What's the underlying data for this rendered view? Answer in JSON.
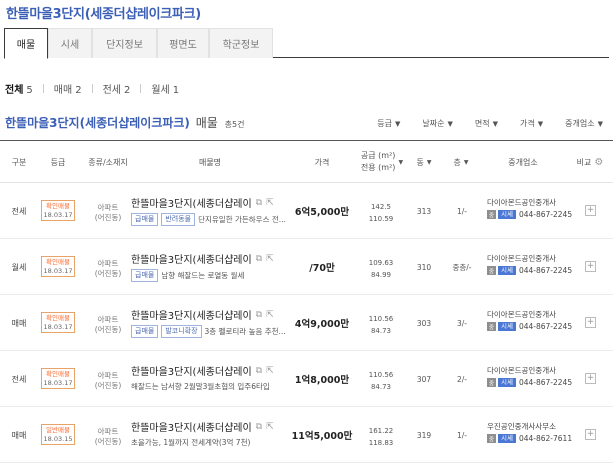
{
  "page": {
    "title": "한뜰마을3단지(세종더샵레이크파크)"
  },
  "tabs": [
    {
      "label": "매물",
      "active": true
    },
    {
      "label": "시세",
      "active": false
    },
    {
      "label": "단지정보",
      "active": false
    },
    {
      "label": "평면도",
      "active": false
    },
    {
      "label": "학군정보",
      "active": false
    }
  ],
  "filters": [
    {
      "label": "전체",
      "count": "5",
      "active": true
    },
    {
      "label": "매매",
      "count": "2",
      "active": false
    },
    {
      "label": "전세",
      "count": "2",
      "active": false
    },
    {
      "label": "월세",
      "count": "1",
      "active": false
    }
  ],
  "section": {
    "name": "한뜰마을3단지(세종더샵레이크파크)",
    "suffix": "매물",
    "total": "총5건"
  },
  "sorts": [
    "등급",
    "날짜순",
    "면적",
    "가격",
    "중개업소"
  ],
  "columns": {
    "type": "구분",
    "grade": "등급",
    "kind": "종류/소재지",
    "name": "매물명",
    "price": "가격",
    "supply": "공급 (m²)",
    "exclusive": "전용 (m²)",
    "dong": "동",
    "floor": "층",
    "agency": "중개업소",
    "compare": "비교"
  },
  "listings": [
    {
      "deal": "전세",
      "grade": "확인매물",
      "date": "18.03.17",
      "kind": "아파트",
      "location": "(어진동)",
      "name": "한뜰마을3단지(세종더샵레이",
      "tags": [
        "급매물",
        "반려동물"
      ],
      "desc": "단지유일한 가든하우스 전...",
      "price": "6억5,000만",
      "supply": "142.5",
      "exclusive": "110.59",
      "dong": "313",
      "floor": "1/-",
      "agency": "다이아몬드공인중개사",
      "phone": "044-867-2245"
    },
    {
      "deal": "월세",
      "grade": "확인매물",
      "date": "18.03.17",
      "kind": "아파트",
      "location": "(어진동)",
      "name": "한뜰마을3단지(세종더샵레이",
      "tags": [
        "급매물"
      ],
      "desc": "남향 해잘드는 로열동 월세",
      "price": "/70만",
      "supply": "109.63",
      "exclusive": "84.99",
      "dong": "310",
      "floor": "중층/-",
      "agency": "다이아몬드공인중개사",
      "phone": "044-867-2245"
    },
    {
      "deal": "매매",
      "grade": "확인매물",
      "date": "18.03.17",
      "kind": "아파트",
      "location": "(어진동)",
      "name": "한뜰마을3단지(세종더샵레이",
      "tags": [
        "급매물",
        "발코니확장"
      ],
      "desc": "3층 펠로티라 높음 추천...",
      "price": "4억9,000만",
      "supply": "110.56",
      "exclusive": "84.73",
      "dong": "303",
      "floor": "3/-",
      "agency": "다이아몬드공인중개사",
      "phone": "044-867-2245"
    },
    {
      "deal": "전세",
      "grade": "확인매물",
      "date": "18.03.17",
      "kind": "아파트",
      "location": "(어진동)",
      "name": "한뜰마을3단지(세종더샵레이",
      "tags": [],
      "desc": "해잘드는 남서향 2월말3월초협의 입주6타입",
      "price": "1억8,000만",
      "supply": "110.56",
      "exclusive": "84.73",
      "dong": "307",
      "floor": "2/-",
      "agency": "다이아몬드공인중개사",
      "phone": "044-867-2245"
    },
    {
      "deal": "매매",
      "grade": "일반매물",
      "date": "18.03.15",
      "kind": "아파트",
      "location": "(어진동)",
      "name": "한뜰마을3단지(세종더샵레이",
      "tags": [],
      "desc": "초을가능, 1월까지 전세계약(3억 7천)",
      "price": "11억5,000만",
      "supply": "161.22",
      "exclusive": "118.83",
      "dong": "319",
      "floor": "1/-",
      "agency": "우진공인중개사사무소",
      "phone": "044-862-7611"
    }
  ],
  "badges": {
    "agent": "중",
    "sise": "시세",
    "plus": "+"
  },
  "colors": {
    "accent": "#3c5fb6",
    "grade_badge": "#ff6a2c",
    "tag_border": "#9fb3dc",
    "sise": "#4a77d4"
  },
  "icons": {
    "copy": "copy-icon",
    "share": "share-icon",
    "settings": "settings-icon",
    "sort_caret": "caret-down-icon"
  }
}
